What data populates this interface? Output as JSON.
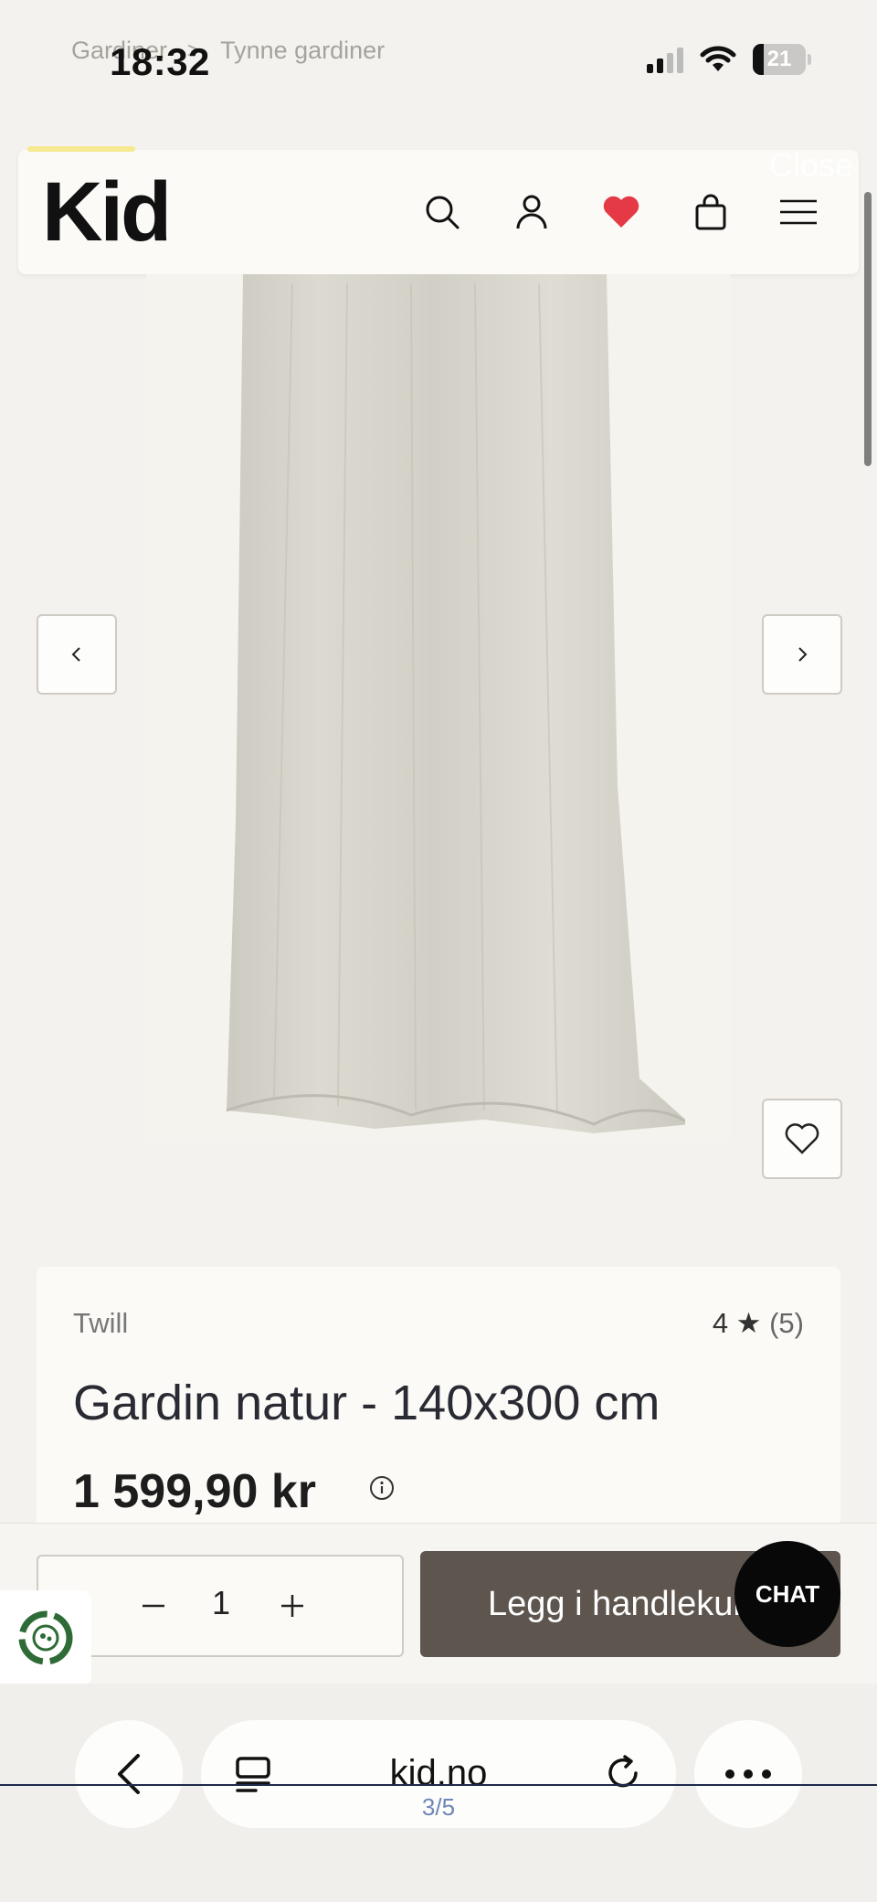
{
  "status_bar": {
    "time": "18:32",
    "battery": "21"
  },
  "breadcrumb": {
    "items": [
      "Gardiner",
      "Tynne gardiner"
    ],
    "separator": ">"
  },
  "header": {
    "logo": "Kid",
    "close_label": "Close",
    "icons": [
      "search-icon",
      "account-icon",
      "heart-icon",
      "bag-icon",
      "menu-icon"
    ],
    "heart_color": "#e53945"
  },
  "gallery": {
    "prev_icon": "chevron-left-icon",
    "next_icon": "chevron-right-icon",
    "wishlist_icon": "heart-outline-icon"
  },
  "product": {
    "brand": "Twill",
    "rating": "4 ★",
    "rating_count": "(5)",
    "title": "Gardin natur - 140x300 cm",
    "price": "1 599,90 kr"
  },
  "purchase": {
    "quantity": "1",
    "add_to_cart_label": "Legg i handlekurv",
    "chat_label": "CHAT",
    "button_color": "#5d554e"
  },
  "browser": {
    "url": "kid.no",
    "page_count": "3/5"
  }
}
